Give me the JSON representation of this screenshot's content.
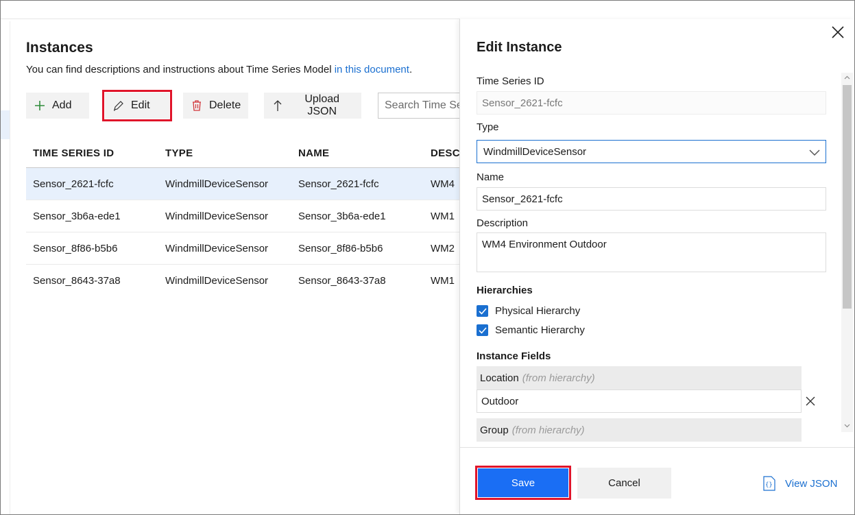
{
  "left": {
    "title": "Instances",
    "description": "You can find descriptions and instructions about Time Series Model ",
    "description_link": "in this document",
    "description_end": ".",
    "toolbar": {
      "add_label": "Add",
      "edit_label": "Edit",
      "delete_label": "Delete",
      "upload_label": "Upload JSON",
      "search_placeholder": "Search Time Series"
    },
    "columns": [
      "TIME SERIES ID",
      "TYPE",
      "NAME",
      "DESCRIPTION"
    ],
    "rows": [
      [
        "Sensor_2621-fcfc",
        "WindmillDeviceSensor",
        "Sensor_2621-fcfc",
        "WM4"
      ],
      [
        "Sensor_3b6a-ede1",
        "WindmillDeviceSensor",
        "Sensor_3b6a-ede1",
        "WM1"
      ],
      [
        "Sensor_8f86-b5b6",
        "WindmillDeviceSensor",
        "Sensor_8f86-b5b6",
        "WM2"
      ],
      [
        "Sensor_8643-37a8",
        "WindmillDeviceSensor",
        "Sensor_8643-37a8",
        "WM1"
      ]
    ]
  },
  "panel": {
    "title": "Edit Instance",
    "ts_id_label": "Time Series ID",
    "ts_id_value": "Sensor_2621-fcfc",
    "type_label": "Type",
    "type_value": "WindmillDeviceSensor",
    "name_label": "Name",
    "name_value": "Sensor_2621-fcfc",
    "description_label": "Description",
    "description_value": "WM4 Environment Outdoor",
    "hierarchies_label": "Hierarchies",
    "hierarchies": [
      "Physical Hierarchy",
      "Semantic Hierarchy"
    ],
    "instance_fields_label": "Instance Fields",
    "fields": [
      {
        "name": "Location",
        "hint": "(from hierarchy)",
        "value": "Outdoor"
      },
      {
        "name": "Group",
        "hint": "(from hierarchy)",
        "value": ""
      }
    ],
    "save_label": "Save",
    "cancel_label": "Cancel",
    "view_json_label": "View JSON"
  },
  "colors": {
    "accent": "#1a6fd0",
    "save_bg": "#1a6ef4",
    "highlight": "#e0142a",
    "selected_row": "#e7f0fc"
  }
}
